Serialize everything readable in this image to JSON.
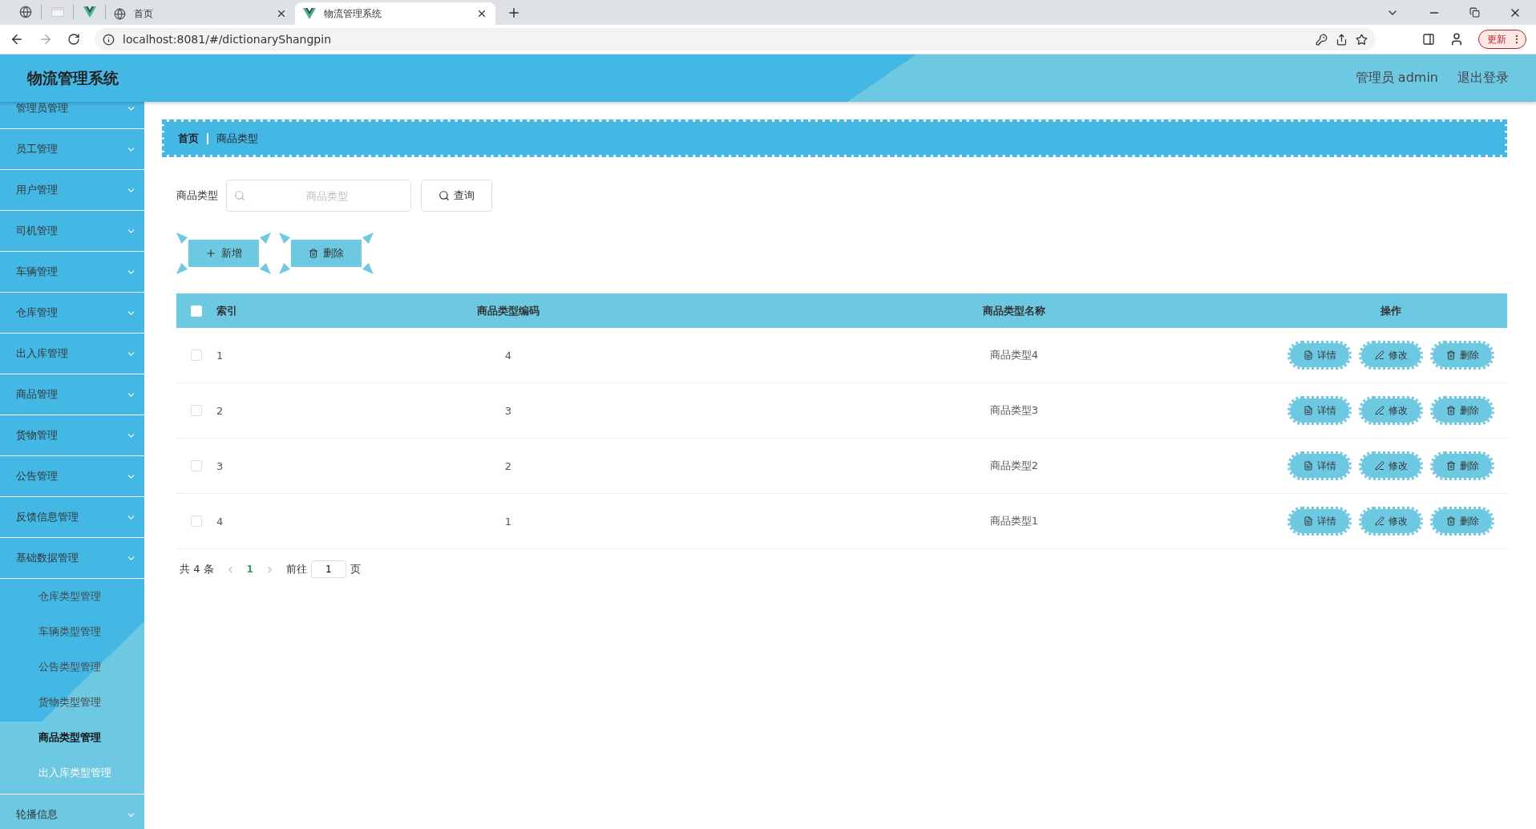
{
  "browser": {
    "tabs": [
      {
        "title": "首页",
        "selected": false
      },
      {
        "title": "物流管理系统",
        "selected": true
      }
    ],
    "url": "localhost:8081/#/dictionaryShangpin",
    "update_button": "更新"
  },
  "header": {
    "title": "物流管理系统",
    "user": "管理员 admin",
    "logout": "退出登录"
  },
  "sidebar": {
    "items": [
      {
        "label": "管理员管理"
      },
      {
        "label": "员工管理"
      },
      {
        "label": "用户管理"
      },
      {
        "label": "司机管理"
      },
      {
        "label": "车辆管理"
      },
      {
        "label": "仓库管理"
      },
      {
        "label": "出入库管理"
      },
      {
        "label": "商品管理"
      },
      {
        "label": "货物管理"
      },
      {
        "label": "公告管理"
      },
      {
        "label": "反馈信息管理"
      },
      {
        "label": "基础数据管理",
        "children": [
          {
            "label": "仓库类型管理",
            "selected": false,
            "hovered": false
          },
          {
            "label": "车辆类型管理",
            "selected": false,
            "hovered": false
          },
          {
            "label": "公告类型管理",
            "selected": false,
            "hovered": false
          },
          {
            "label": "货物类型管理",
            "selected": false,
            "hovered": false
          },
          {
            "label": "商品类型管理",
            "selected": true,
            "hovered": false
          },
          {
            "label": "出入库类型管理",
            "selected": false,
            "hovered": true
          }
        ]
      },
      {
        "label": "轮播信息"
      }
    ]
  },
  "breadcrumb": [
    "首页",
    "商品类型"
  ],
  "search": {
    "label": "商品类型",
    "placeholder": "商品类型",
    "button": "查询"
  },
  "actions": [
    {
      "kind": "add",
      "label": "新增"
    },
    {
      "kind": "delete",
      "label": "删除"
    }
  ],
  "table": {
    "columns": [
      "索引",
      "商品类型编码",
      "商品类型名称",
      "操作"
    ],
    "all_checked": false,
    "rows": [
      {
        "checked": false,
        "cells": [
          "1",
          "4",
          "商品类型4"
        ],
        "actions": [
          {
            "kind": "detail",
            "label": "详情"
          },
          {
            "kind": "edit",
            "label": "修改"
          },
          {
            "kind": "delete",
            "label": "删除"
          }
        ]
      },
      {
        "checked": false,
        "cells": [
          "2",
          "3",
          "商品类型3"
        ],
        "actions": [
          {
            "kind": "detail",
            "label": "详情"
          },
          {
            "kind": "edit",
            "label": "修改"
          },
          {
            "kind": "delete",
            "label": "删除"
          }
        ]
      },
      {
        "checked": false,
        "cells": [
          "3",
          "2",
          "商品类型2"
        ],
        "actions": [
          {
            "kind": "detail",
            "label": "详情"
          },
          {
            "kind": "edit",
            "label": "修改"
          },
          {
            "kind": "delete",
            "label": "删除"
          }
        ]
      },
      {
        "checked": false,
        "cells": [
          "4",
          "1",
          "商品类型1"
        ],
        "actions": [
          {
            "kind": "detail",
            "label": "详情"
          },
          {
            "kind": "edit",
            "label": "修改"
          },
          {
            "kind": "delete",
            "label": "删除"
          }
        ]
      }
    ]
  },
  "pagination": {
    "total": "共 4 条",
    "pages": [
      {
        "label": "1",
        "selected": true
      }
    ],
    "goto_label": "前往",
    "goto_value": "1",
    "page_suffix": "页"
  }
}
